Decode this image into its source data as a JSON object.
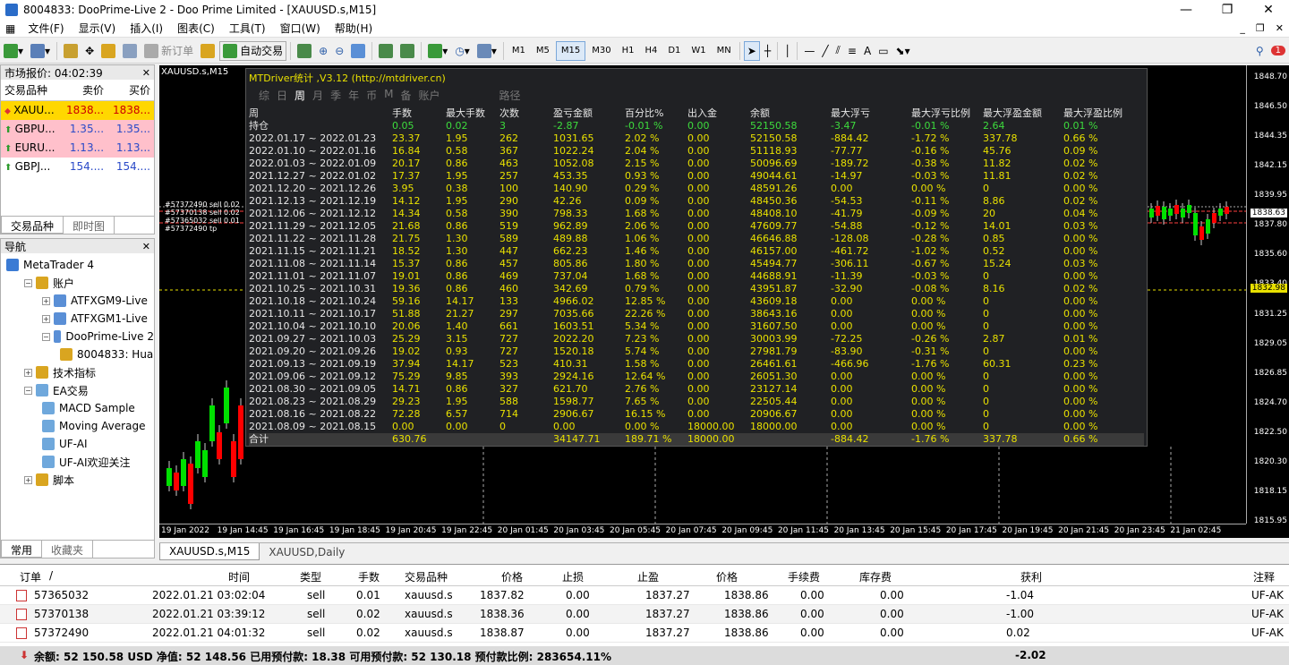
{
  "window": {
    "title": "8004833: DooPrime-Live 2 - Doo Prime Limited - [XAUUSD.s,M15]",
    "min": "—",
    "max": "❐",
    "close": "✕"
  },
  "menu": [
    "文件(F)",
    "显示(V)",
    "插入(I)",
    "图表(C)",
    "工具(T)",
    "窗口(W)",
    "帮助(H)"
  ],
  "mdi": [
    "_",
    "❐",
    "✕"
  ],
  "toolbar": {
    "new_order": "新订单",
    "auto_trade": "自动交易",
    "timeframes": [
      "M1",
      "M5",
      "M15",
      "M30",
      "H1",
      "H4",
      "D1",
      "W1",
      "MN"
    ],
    "active_tf": "M15",
    "notify_count": "1"
  },
  "market_watch": {
    "title": "市场报价: 04:02:39",
    "columns": [
      "交易品种",
      "卖价",
      "买价"
    ],
    "rows": [
      {
        "symbol": "XAUU...",
        "bid": "1838...",
        "ask": "1838...",
        "bg": "#ffd700"
      },
      {
        "symbol": "GBPU...",
        "bid": "1.35...",
        "ask": "1.35...",
        "bg": "#ffc0cb"
      },
      {
        "symbol": "EURU...",
        "bid": "1.13...",
        "ask": "1.13...",
        "bg": "#ffc0cb"
      },
      {
        "symbol": "GBPJ...",
        "bid": "154....",
        "ask": "154....",
        "bg": "#ffffff"
      }
    ],
    "tabs": [
      "交易品种",
      "即时图"
    ]
  },
  "navigator": {
    "title": "导航",
    "items": [
      {
        "label": "MetaTrader 4",
        "level": 0,
        "color": "#3b7bd4"
      },
      {
        "label": "账户",
        "level": 1,
        "color": "#d9a520"
      },
      {
        "label": "ATFXGM9-Live",
        "level": 2,
        "color": "#5a8fd6"
      },
      {
        "label": "ATFXGM1-Live",
        "level": 2,
        "color": "#5a8fd6"
      },
      {
        "label": "DooPrime-Live 2",
        "level": 2,
        "color": "#5a8fd6"
      },
      {
        "label": "8004833: Hua",
        "level": 3,
        "color": "#d9a520"
      },
      {
        "label": "技术指标",
        "level": 1,
        "color": "#d9a520"
      },
      {
        "label": "EA交易",
        "level": 1,
        "color": "#6fa8dc"
      },
      {
        "label": "MACD Sample",
        "level": 2,
        "color": "#6fa8dc"
      },
      {
        "label": "Moving Average",
        "level": 2,
        "color": "#6fa8dc"
      },
      {
        "label": "UF-AI",
        "level": 2,
        "color": "#6fa8dc"
      },
      {
        "label": "UF-AI欢迎关注",
        "level": 2,
        "color": "#6fa8dc"
      },
      {
        "label": "脚本",
        "level": 1,
        "color": "#d9a520"
      }
    ],
    "tabs": [
      "常用",
      "收藏夹"
    ]
  },
  "chart": {
    "tag": "XAUUSD.s,M15",
    "price_labels": [
      "1848.70",
      "1846.50",
      "1844.35",
      "1842.15",
      "1839.95",
      "1837.80",
      "1835.60",
      "1833.40",
      "1831.25",
      "1829.05",
      "1826.85",
      "1824.70",
      "1822.50",
      "1820.30",
      "1818.15",
      "1815.95"
    ],
    "current_price": "1838.63",
    "line_price": "1832.98",
    "time_labels": [
      "19 Jan 2022",
      "19 Jan 14:45",
      "19 Jan 16:45",
      "19 Jan 18:45",
      "19 Jan 20:45",
      "19 Jan 22:45",
      "20 Jan 01:45",
      "20 Jan 03:45",
      "20 Jan 05:45",
      "20 Jan 07:45",
      "20 Jan 09:45",
      "20 Jan 11:45",
      "20 Jan 13:45",
      "20 Jan 15:45",
      "20 Jan 17:45",
      "20 Jan 19:45",
      "20 Jan 21:45",
      "20 Jan 23:45",
      "21 Jan 02:45"
    ],
    "order_labels": [
      "#57372490 sell 0.02",
      "#57370138 sell 0.02",
      "#57365032 sell 0.01",
      "#57372490 tp"
    ]
  },
  "stats": {
    "title": "MTDriver统计 ,V3.12 (http://mtdriver.cn)",
    "tabs": [
      "综",
      "日",
      "周",
      "月",
      "季",
      "年",
      "币",
      "M",
      "备",
      "账户",
      "路径"
    ],
    "active_tab": "周",
    "headers": [
      "周",
      "手数",
      "最大手数",
      "次数",
      "盈亏金额",
      "百分比%",
      "出入金",
      "余额",
      "最大浮亏",
      "最大浮亏比例",
      "最大浮盈金额",
      "最大浮盈比例"
    ],
    "holding": [
      "持仓",
      "0.05",
      "0.02",
      "3",
      "-2.87",
      "-0.01 %",
      "0.00",
      "52150.58",
      "-3.47",
      "-0.01 %",
      "2.64",
      "0.01 %"
    ],
    "rows": [
      [
        "2022.01.17 ~ 2022.01.23",
        "23.37",
        "1.95",
        "262",
        "1031.65",
        "2.02 %",
        "0.00",
        "52150.58",
        "-884.42",
        "-1.72 %",
        "337.78",
        "0.66 %"
      ],
      [
        "2022.01.10 ~ 2022.01.16",
        "16.84",
        "0.58",
        "367",
        "1022.24",
        "2.04 %",
        "0.00",
        "51118.93",
        "-77.77",
        "-0.16 %",
        "45.76",
        "0.09 %"
      ],
      [
        "2022.01.03 ~ 2022.01.09",
        "20.17",
        "0.86",
        "463",
        "1052.08",
        "2.15 %",
        "0.00",
        "50096.69",
        "-189.72",
        "-0.38 %",
        "11.82",
        "0.02 %"
      ],
      [
        "2021.12.27 ~ 2022.01.02",
        "17.37",
        "1.95",
        "257",
        "453.35",
        "0.93 %",
        "0.00",
        "49044.61",
        "-14.97",
        "-0.03 %",
        "11.81",
        "0.02 %"
      ],
      [
        "2021.12.20 ~ 2021.12.26",
        "3.95",
        "0.38",
        "100",
        "140.90",
        "0.29 %",
        "0.00",
        "48591.26",
        "0.00",
        "0.00 %",
        "0",
        "0.00 %"
      ],
      [
        "2021.12.13 ~ 2021.12.19",
        "14.12",
        "1.95",
        "290",
        "42.26",
        "0.09 %",
        "0.00",
        "48450.36",
        "-54.53",
        "-0.11 %",
        "8.86",
        "0.02 %"
      ],
      [
        "2021.12.06 ~ 2021.12.12",
        "14.34",
        "0.58",
        "390",
        "798.33",
        "1.68 %",
        "0.00",
        "48408.10",
        "-41.79",
        "-0.09 %",
        "20",
        "0.04 %"
      ],
      [
        "2021.11.29 ~ 2021.12.05",
        "21.68",
        "0.86",
        "519",
        "962.89",
        "2.06 %",
        "0.00",
        "47609.77",
        "-54.88",
        "-0.12 %",
        "14.01",
        "0.03 %"
      ],
      [
        "2021.11.22 ~ 2021.11.28",
        "21.75",
        "1.30",
        "589",
        "489.88",
        "1.06 %",
        "0.00",
        "46646.88",
        "-128.08",
        "-0.28 %",
        "0.85",
        "0.00 %"
      ],
      [
        "2021.11.15 ~ 2021.11.21",
        "18.52",
        "1.30",
        "447",
        "662.23",
        "1.46 %",
        "0.00",
        "46157.00",
        "-461.72",
        "-1.02 %",
        "0.52",
        "0.00 %"
      ],
      [
        "2021.11.08 ~ 2021.11.14",
        "15.37",
        "0.86",
        "457",
        "805.86",
        "1.80 %",
        "0.00",
        "45494.77",
        "-306.11",
        "-0.67 %",
        "15.24",
        "0.03 %"
      ],
      [
        "2021.11.01 ~ 2021.11.07",
        "19.01",
        "0.86",
        "469",
        "737.04",
        "1.68 %",
        "0.00",
        "44688.91",
        "-11.39",
        "-0.03 %",
        "0",
        "0.00 %"
      ],
      [
        "2021.10.25 ~ 2021.10.31",
        "19.36",
        "0.86",
        "460",
        "342.69",
        "0.79 %",
        "0.00",
        "43951.87",
        "-32.90",
        "-0.08 %",
        "8.16",
        "0.02 %"
      ],
      [
        "2021.10.18 ~ 2021.10.24",
        "59.16",
        "14.17",
        "133",
        "4966.02",
        "12.85 %",
        "0.00",
        "43609.18",
        "0.00",
        "0.00 %",
        "0",
        "0.00 %"
      ],
      [
        "2021.10.11 ~ 2021.10.17",
        "51.88",
        "21.27",
        "297",
        "7035.66",
        "22.26 %",
        "0.00",
        "38643.16",
        "0.00",
        "0.00 %",
        "0",
        "0.00 %"
      ],
      [
        "2021.10.04 ~ 2021.10.10",
        "20.06",
        "1.40",
        "661",
        "1603.51",
        "5.34 %",
        "0.00",
        "31607.50",
        "0.00",
        "0.00 %",
        "0",
        "0.00 %"
      ],
      [
        "2021.09.27 ~ 2021.10.03",
        "25.29",
        "3.15",
        "727",
        "2022.20",
        "7.23 %",
        "0.00",
        "30003.99",
        "-72.25",
        "-0.26 %",
        "2.87",
        "0.01 %"
      ],
      [
        "2021.09.20 ~ 2021.09.26",
        "19.02",
        "0.93",
        "727",
        "1520.18",
        "5.74 %",
        "0.00",
        "27981.79",
        "-83.90",
        "-0.31 %",
        "0",
        "0.00 %"
      ],
      [
        "2021.09.13 ~ 2021.09.19",
        "37.94",
        "14.17",
        "523",
        "410.31",
        "1.58 %",
        "0.00",
        "26461.61",
        "-466.96",
        "-1.76 %",
        "60.31",
        "0.23 %"
      ],
      [
        "2021.09.06 ~ 2021.09.12",
        "75.29",
        "9.85",
        "393",
        "2924.16",
        "12.64 %",
        "0.00",
        "26051.30",
        "0.00",
        "0.00 %",
        "0",
        "0.00 %"
      ],
      [
        "2021.08.30 ~ 2021.09.05",
        "14.71",
        "0.86",
        "327",
        "621.70",
        "2.76 %",
        "0.00",
        "23127.14",
        "0.00",
        "0.00 %",
        "0",
        "0.00 %"
      ],
      [
        "2021.08.23 ~ 2021.08.29",
        "29.23",
        "1.95",
        "588",
        "1598.77",
        "7.65 %",
        "0.00",
        "22505.44",
        "0.00",
        "0.00 %",
        "0",
        "0.00 %"
      ],
      [
        "2021.08.16 ~ 2021.08.22",
        "72.28",
        "6.57",
        "714",
        "2906.67",
        "16.15 %",
        "0.00",
        "20906.67",
        "0.00",
        "0.00 %",
        "0",
        "0.00 %"
      ],
      [
        "2021.08.09 ~ 2021.08.15",
        "0.00",
        "0.00",
        "0",
        "0.00",
        "0.00 %",
        "18000.00",
        "18000.00",
        "0.00",
        "0.00 %",
        "0",
        "0.00 %"
      ]
    ],
    "total": [
      "合计",
      "630.76",
      "",
      "",
      "34147.71",
      "189.71 %",
      "18000.00",
      "",
      "-884.42",
      "-1.76 %",
      "337.78",
      "0.66 %"
    ]
  },
  "chart_tabs": [
    "XAUUSD.s,M15",
    "XAUUSD,Daily"
  ],
  "terminal": {
    "headers": [
      "订单",
      "/",
      "时间",
      "类型",
      "手数",
      "交易品种",
      "价格",
      "止损",
      "止盈",
      "价格",
      "手续费",
      "库存费",
      "获利",
      "注释"
    ],
    "rows": [
      [
        "57365032",
        "2022.01.21 03:02:04",
        "sell",
        "0.01",
        "xauusd.s",
        "1837.82",
        "0.00",
        "1837.27",
        "1838.86",
        "0.00",
        "0.00",
        "-1.04",
        "UF-AK"
      ],
      [
        "57370138",
        "2022.01.21 03:39:12",
        "sell",
        "0.02",
        "xauusd.s",
        "1838.36",
        "0.00",
        "1837.27",
        "1838.86",
        "0.00",
        "0.00",
        "-1.00",
        "UF-AK"
      ],
      [
        "57372490",
        "2022.01.21 04:01:32",
        "sell",
        "0.02",
        "xauusd.s",
        "1838.87",
        "0.00",
        "1837.27",
        "1838.86",
        "0.00",
        "0.00",
        "0.02",
        "UF-AK"
      ]
    ],
    "balance": "余额: 52 150.58 USD  净值: 52 148.56  已用预付款: 18.38  可用预付款: 52 130.18  预付款比例: 283654.11%",
    "total_profit": "-2.02"
  },
  "colors": {
    "chart_bg": "#000000",
    "bull": "#00e000",
    "bear": "#ff0000",
    "stats_yellow": "#e8e000"
  }
}
